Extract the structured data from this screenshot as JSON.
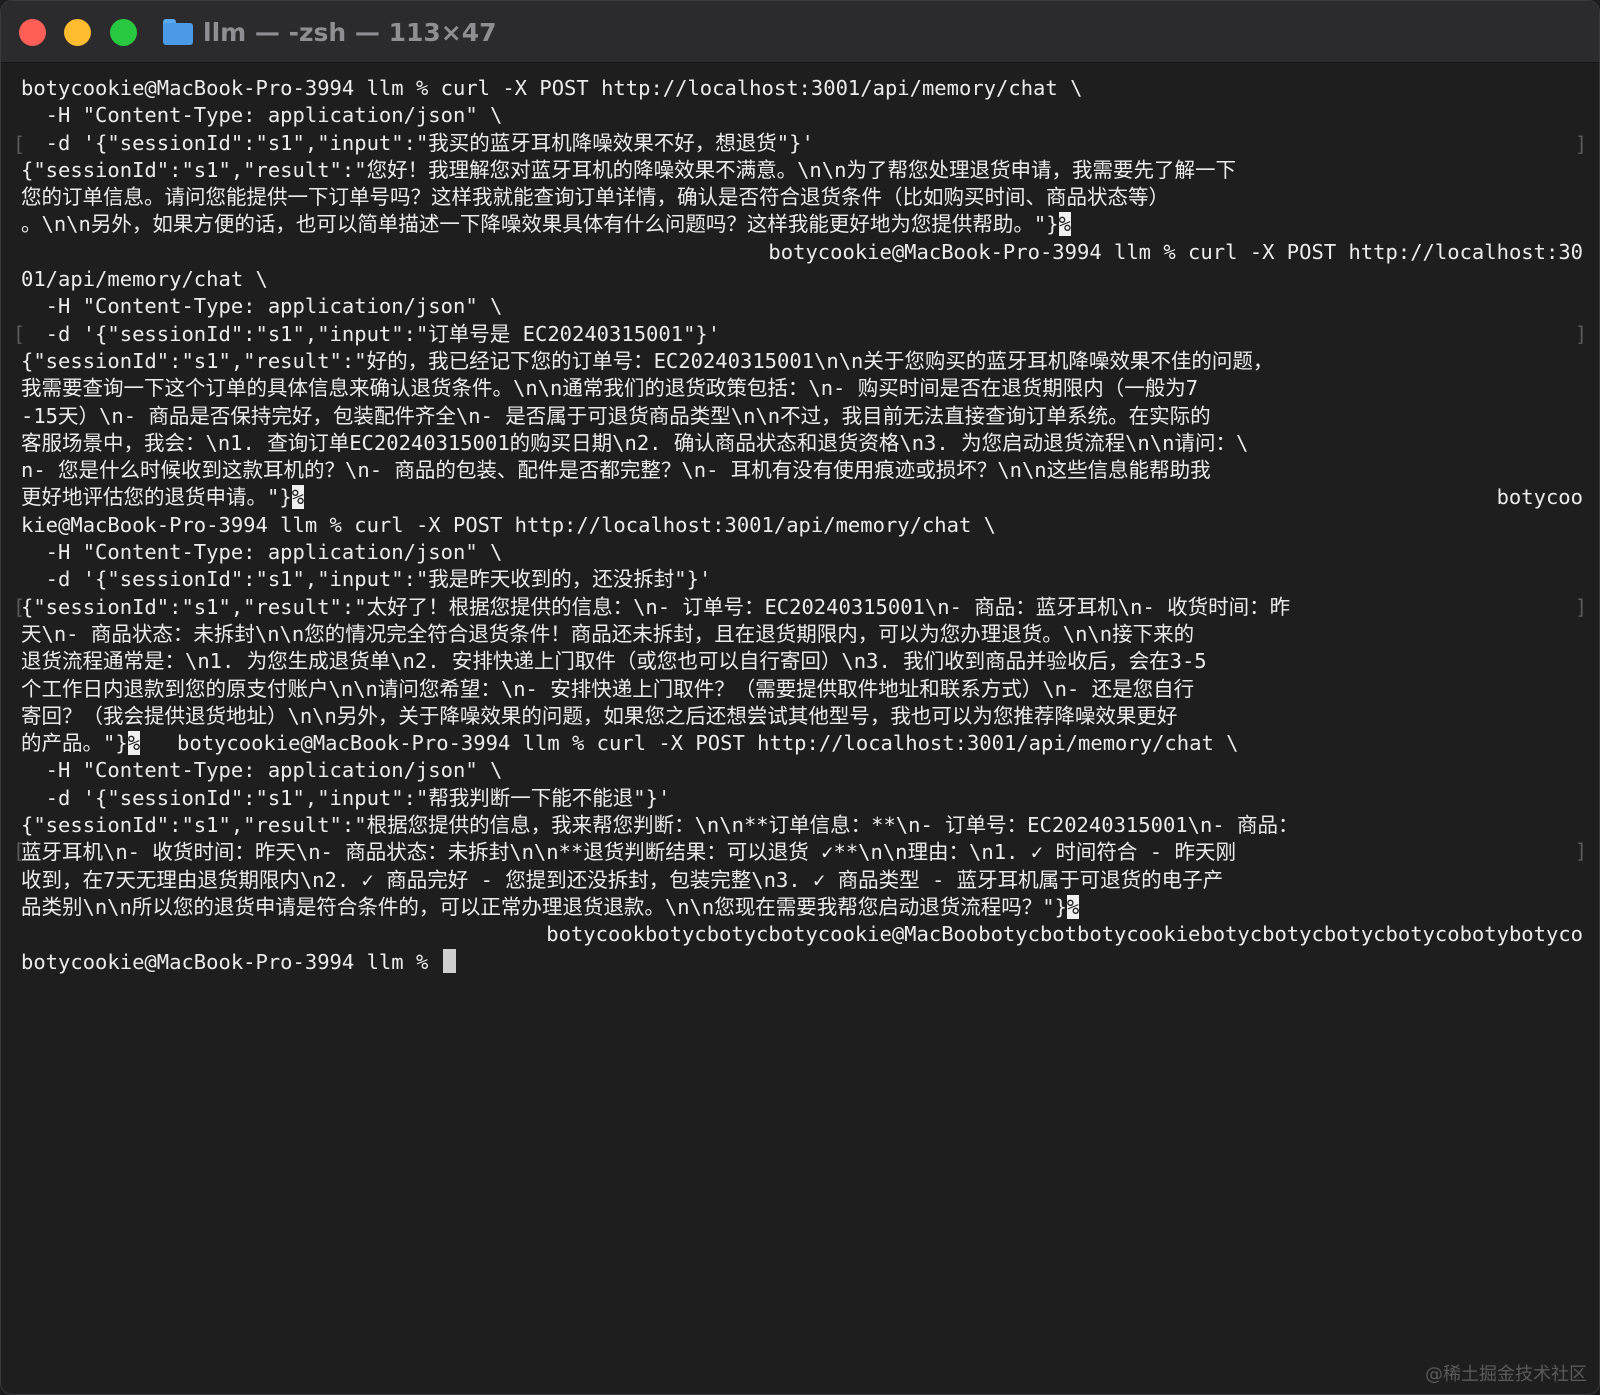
{
  "window": {
    "title": "llm — -zsh — 113×47"
  },
  "terminal": {
    "lines": [
      {
        "text": "botycookie@MacBook-Pro-3994 llm % curl -X POST http://localhost:3001/api/memory/chat \\"
      },
      {
        "text": "  -H \"Content-Type: application/json\" \\"
      },
      {
        "text": "  -d '{\"sessionId\":\"s1\",\"input\":\"我买的蓝牙耳机降噪效果不好，想退货\"}'"
      },
      {
        "text": "{\"sessionId\":\"s1\",\"result\":\"您好！我理解您对蓝牙耳机的降噪效果不满意。\\n\\n为了帮您处理退货申请，我需要先了解一下"
      },
      {
        "text": "您的订单信息。请问您能提供一下订单号吗？这样我就能查询订单详情，确认是否符合退货条件（比如购买时间、商品状态等）"
      },
      {
        "text": "。\\n\\n另外，如果方便的话，也可以简单描述一下降噪效果具体有什么问题吗？这样我能更好地为您提供帮助。\"}",
        "mark": "%"
      },
      {
        "text": "botycookie@MacBook-Pro-3994 llm % curl -X POST http://localhost:30",
        "align": "right"
      },
      {
        "text": "01/api/memory/chat \\"
      },
      {
        "text": "  -H \"Content-Type: application/json\" \\"
      },
      {
        "text": "  -d '{\"sessionId\":\"s1\",\"input\":\"订单号是 EC20240315001\"}'"
      },
      {
        "text": "{\"sessionId\":\"s1\",\"result\":\"好的，我已经记下您的订单号：EC20240315001\\n\\n关于您购买的蓝牙耳机降噪效果不佳的问题，"
      },
      {
        "text": "我需要查询一下这个订单的具体信息来确认退货条件。\\n\\n通常我们的退货政策包括：\\n- 购买时间是否在退货期限内（一般为7"
      },
      {
        "text": "-15天）\\n- 商品是否保持完好，包装配件齐全\\n- 是否属于可退货商品类型\\n\\n不过，我目前无法直接查询订单系统。在实际的"
      },
      {
        "text": "客服场景中，我会：\\n1. 查询订单EC20240315001的购买日期\\n2. 确认商品状态和退货资格\\n3. 为您启动退货流程\\n\\n请问：\\"
      },
      {
        "text": "n- 您是什么时候收到这款耳机的？\\n- 商品的包装、配件是否都完整？\\n- 耳机有没有使用痕迹或损坏？\\n\\n这些信息能帮助我"
      },
      {
        "text": "更好地评估您的退货申请。\"}",
        "mark": "%",
        "tail": "botycoo"
      },
      {
        "text": "kie@MacBook-Pro-3994 llm % curl -X POST http://localhost:3001/api/memory/chat \\"
      },
      {
        "text": "  -H \"Content-Type: application/json\" \\"
      },
      {
        "text": "  -d '{\"sessionId\":\"s1\",\"input\":\"我是昨天收到的，还没拆封\"}'"
      },
      {
        "text": "{\"sessionId\":\"s1\",\"result\":\"太好了！根据您提供的信息：\\n- 订单号：EC20240315001\\n- 商品：蓝牙耳机\\n- 收货时间：昨"
      },
      {
        "text": "天\\n- 商品状态：未拆封\\n\\n您的情况完全符合退货条件！商品还未拆封，且在退货期限内，可以为您办理退货。\\n\\n接下来的"
      },
      {
        "text": "退货流程通常是：\\n1. 为您生成退货单\\n2. 安排快递上门取件（或您也可以自行寄回）\\n3. 我们收到商品并验收后，会在3-5"
      },
      {
        "text": "个工作日内退款到您的原支付账户\\n\\n请问您希望：\\n- 安排快递上门取件？（需要提供取件地址和联系方式）\\n- 还是您自行"
      },
      {
        "text": "寄回？（我会提供退货地址）\\n\\n另外，关于降噪效果的问题，如果您之后还想尝试其他型号，我也可以为您推荐降噪效果更好"
      },
      {
        "text": "的产品。\"}",
        "mark": "%",
        "tail": "   botycookie@MacBook-Pro-3994 llm % curl -X POST http://localhost:3001/api/memory/chat \\"
      },
      {
        "text": "  -H \"Content-Type: application/json\" \\"
      },
      {
        "text": "  -d '{\"sessionId\":\"s1\",\"input\":\"帮我判断一下能不能退\"}'"
      },
      {
        "text": "{\"sessionId\":\"s1\",\"result\":\"根据您提供的信息，我来帮您判断：\\n\\n**订单信息：**\\n- 订单号：EC20240315001\\n- 商品："
      },
      {
        "text": "蓝牙耳机\\n- 收货时间：昨天\\n- 商品状态：未拆封\\n\\n**退货判断结果：可以退货 ✓**\\n\\n理由：\\n1. ✓ 时间符合 - 昨天刚"
      },
      {
        "text": "收到，在7天无理由退货期限内\\n2. ✓ 商品完好 - 您提到还没拆封，包装完整\\n3. ✓ 商品类型 - 蓝牙耳机属于可退货的电子产"
      },
      {
        "text": "品类别\\n\\n所以您的退货申请是符合条件的，可以正常办理退货退款。\\n\\n您现在需要我帮您启动退货流程吗？\"}",
        "mark": "%"
      },
      {
        "text": "botycookbotycbotycbotycookie@MacBoobotycbotbotycookiebotycbotycbotycbotycobotybotyco",
        "align": "right"
      },
      {
        "text": "botycookie@MacBook-Pro-3994 llm % ",
        "cursor": true
      }
    ]
  },
  "watermark": "@稀土掘金技术社区"
}
